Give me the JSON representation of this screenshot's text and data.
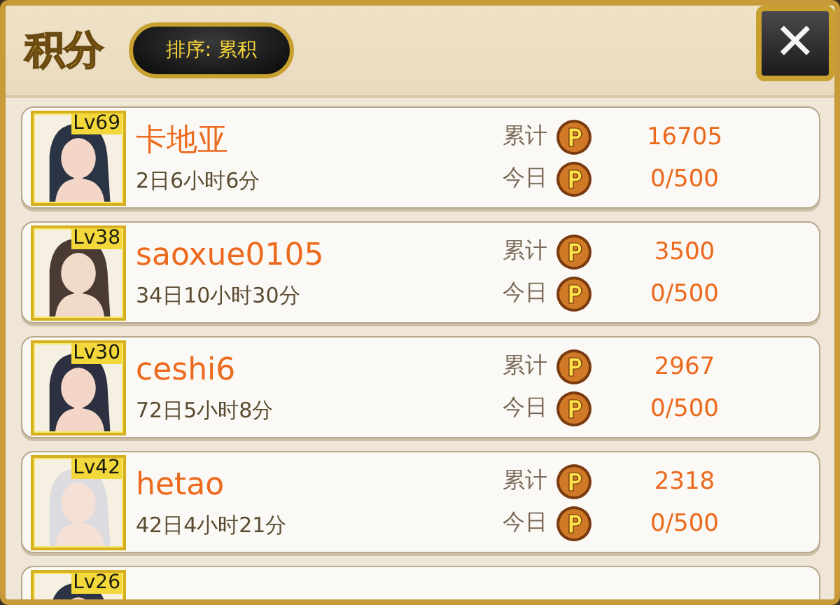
{
  "title": "积分",
  "sort_button": "排序: 累积",
  "close_button": "✕",
  "rows": [
    {
      "level": "Lv69",
      "name": "卡地亚",
      "time": "2日6小时6分",
      "total_label": "累计",
      "total": "16705",
      "today_label": "今日",
      "today": "0/500"
    },
    {
      "level": "Lv38",
      "name": "saoxue0105",
      "time": "34日10小时30分",
      "total_label": "累计",
      "total": "3500",
      "today_label": "今日",
      "today": "0/500"
    },
    {
      "level": "Lv30",
      "name": "ceshi6",
      "time": "72日5小时8分",
      "total_label": "累计",
      "total": "2967",
      "today_label": "今日",
      "today": "0/500"
    },
    {
      "level": "Lv42",
      "name": "hetao",
      "time": "42日4小时21分",
      "total_label": "累计",
      "total": "2318",
      "today_label": "今日",
      "today": "0/500"
    },
    {
      "level": "Lv26"
    }
  ]
}
